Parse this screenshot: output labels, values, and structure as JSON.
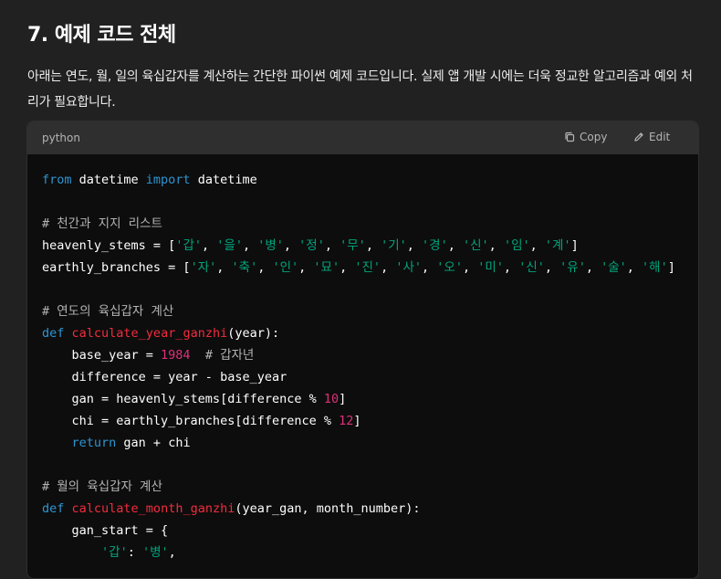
{
  "section": {
    "heading": "7. 예제 코드 전체",
    "paragraph": "아래는 연도, 월, 일의 육십갑자를 계산하는 간단한 파이썬 예제 코드입니다. 실제 앱 개발 시에는 더욱 정교한 알고리즘과 예외 처리가 필요합니다."
  },
  "code_block": {
    "language": "python",
    "copy_label": "Copy",
    "edit_label": "Edit",
    "lines": [
      [
        {
          "t": "from",
          "c": "kw"
        },
        {
          "t": " datetime "
        },
        {
          "t": "import",
          "c": "kw"
        },
        {
          "t": " datetime"
        }
      ],
      [],
      [
        {
          "t": "# 천간과 지지 리스트",
          "c": "cm"
        }
      ],
      [
        {
          "t": "heavenly_stems = ["
        },
        {
          "t": "'갑'",
          "c": "str"
        },
        {
          "t": ", "
        },
        {
          "t": "'을'",
          "c": "str"
        },
        {
          "t": ", "
        },
        {
          "t": "'병'",
          "c": "str"
        },
        {
          "t": ", "
        },
        {
          "t": "'정'",
          "c": "str"
        },
        {
          "t": ", "
        },
        {
          "t": "'무'",
          "c": "str"
        },
        {
          "t": ", "
        },
        {
          "t": "'기'",
          "c": "str"
        },
        {
          "t": ", "
        },
        {
          "t": "'경'",
          "c": "str"
        },
        {
          "t": ", "
        },
        {
          "t": "'신'",
          "c": "str"
        },
        {
          "t": ", "
        },
        {
          "t": "'임'",
          "c": "str"
        },
        {
          "t": ", "
        },
        {
          "t": "'계'",
          "c": "str"
        },
        {
          "t": "]"
        }
      ],
      [
        {
          "t": "earthly_branches = ["
        },
        {
          "t": "'자'",
          "c": "str"
        },
        {
          "t": ", "
        },
        {
          "t": "'축'",
          "c": "str"
        },
        {
          "t": ", "
        },
        {
          "t": "'인'",
          "c": "str"
        },
        {
          "t": ", "
        },
        {
          "t": "'묘'",
          "c": "str"
        },
        {
          "t": ", "
        },
        {
          "t": "'진'",
          "c": "str"
        },
        {
          "t": ", "
        },
        {
          "t": "'사'",
          "c": "str"
        },
        {
          "t": ", "
        },
        {
          "t": "'오'",
          "c": "str"
        },
        {
          "t": ", "
        },
        {
          "t": "'미'",
          "c": "str"
        },
        {
          "t": ", "
        },
        {
          "t": "'신'",
          "c": "str"
        },
        {
          "t": ", "
        },
        {
          "t": "'유'",
          "c": "str"
        },
        {
          "t": ", "
        },
        {
          "t": "'술'",
          "c": "str"
        },
        {
          "t": ", "
        },
        {
          "t": "'해'",
          "c": "str"
        },
        {
          "t": "]"
        }
      ],
      [],
      [
        {
          "t": "# 연도의 육십갑자 계산",
          "c": "cm"
        }
      ],
      [
        {
          "t": "def",
          "c": "kw"
        },
        {
          "t": " "
        },
        {
          "t": "calculate_year_ganzhi",
          "c": "fn"
        },
        {
          "t": "(year):"
        }
      ],
      [
        {
          "t": "    base_year = "
        },
        {
          "t": "1984",
          "c": "num"
        },
        {
          "t": "  "
        },
        {
          "t": "# 갑자년",
          "c": "cm"
        }
      ],
      [
        {
          "t": "    difference = year - base_year"
        }
      ],
      [
        {
          "t": "    gan = heavenly_stems[difference % "
        },
        {
          "t": "10",
          "c": "num"
        },
        {
          "t": "]"
        }
      ],
      [
        {
          "t": "    chi = earthly_branches[difference % "
        },
        {
          "t": "12",
          "c": "num"
        },
        {
          "t": "]"
        }
      ],
      [
        {
          "t": "    "
        },
        {
          "t": "return",
          "c": "kw"
        },
        {
          "t": " gan + chi"
        }
      ],
      [],
      [
        {
          "t": "# 월의 육십갑자 계산",
          "c": "cm"
        }
      ],
      [
        {
          "t": "def",
          "c": "kw"
        },
        {
          "t": " "
        },
        {
          "t": "calculate_month_ganzhi",
          "c": "fn"
        },
        {
          "t": "(year_gan, month_number):"
        }
      ],
      [
        {
          "t": "    gan_start = {"
        }
      ],
      [
        {
          "t": "        "
        },
        {
          "t": "'갑'",
          "c": "str"
        },
        {
          "t": ": "
        },
        {
          "t": "'병'",
          "c": "str"
        },
        {
          "t": ","
        }
      ]
    ]
  }
}
